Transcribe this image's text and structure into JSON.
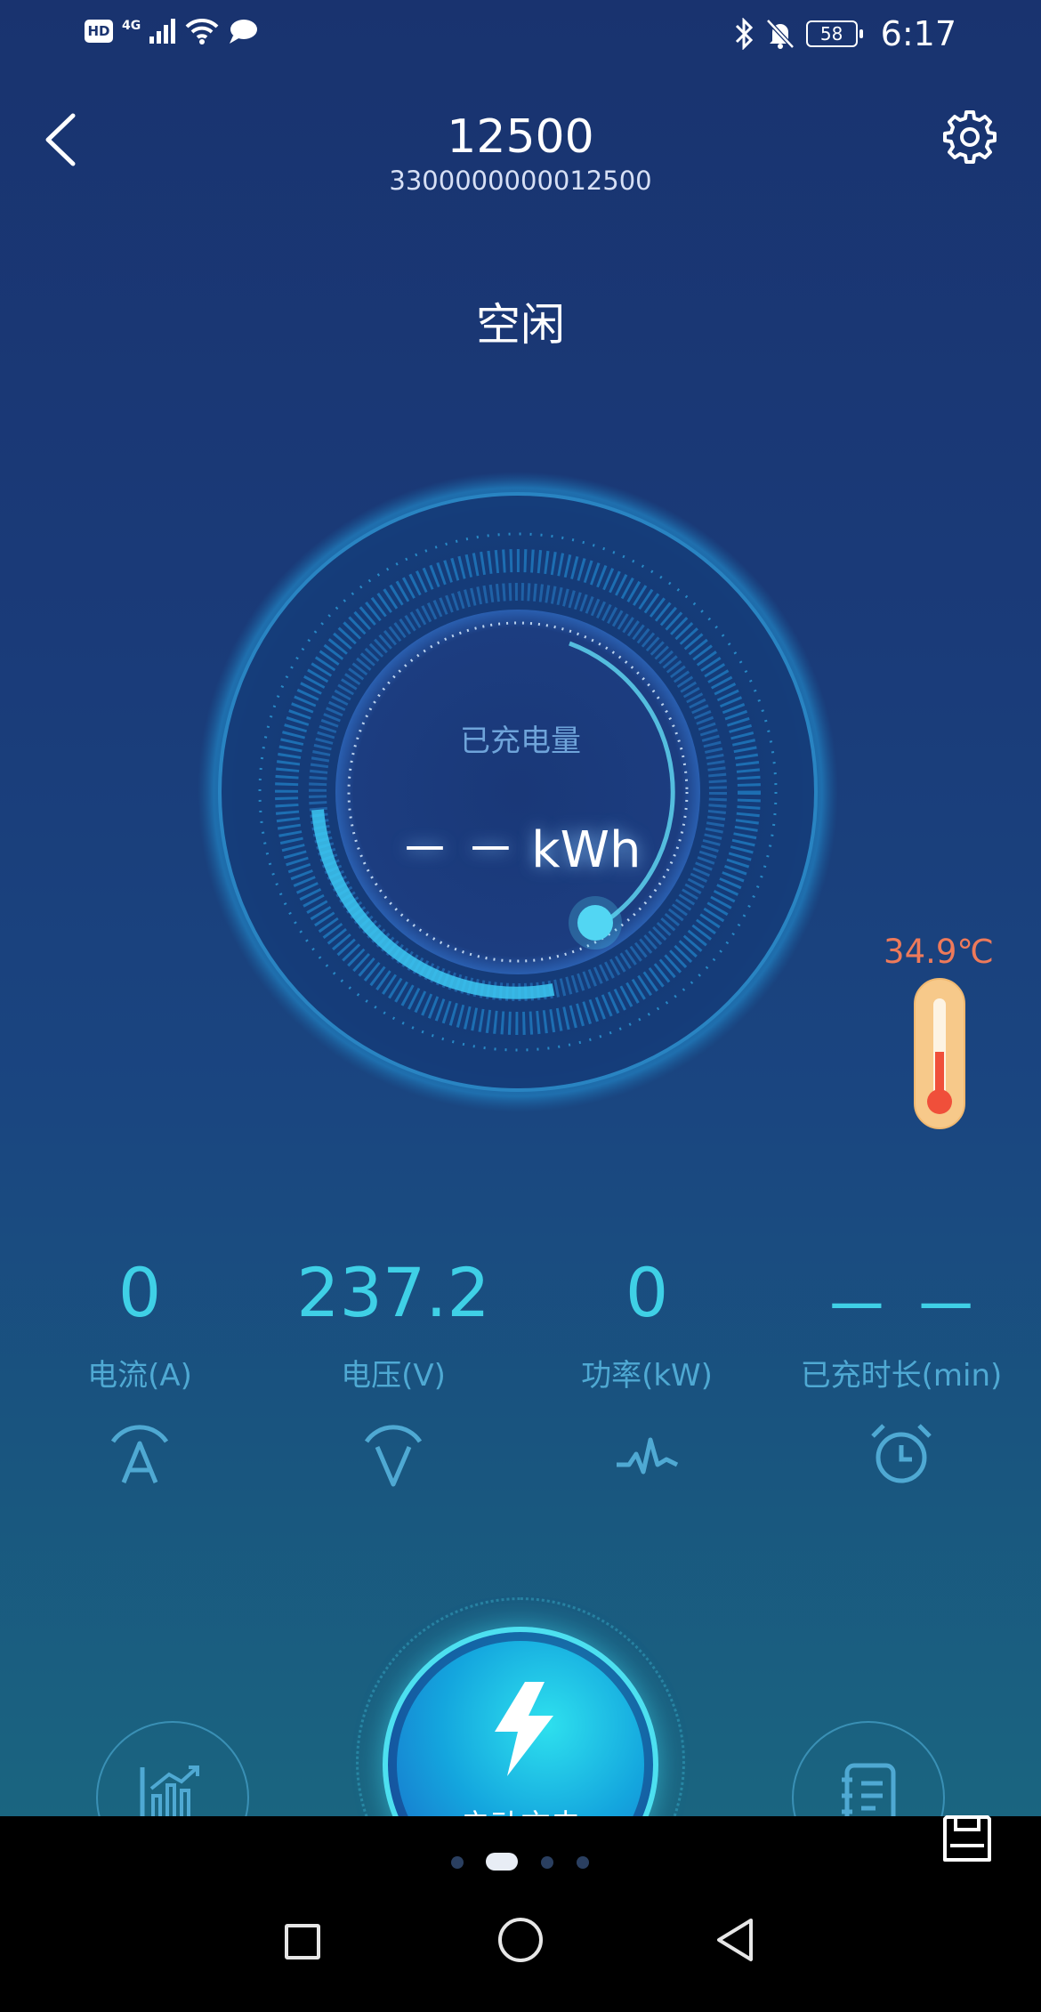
{
  "status_bar": {
    "hd": "HD",
    "network": "4G",
    "battery": "58",
    "time": "6:17"
  },
  "header": {
    "title": "12500",
    "subtitle": "3300000000012500"
  },
  "state": "空闲",
  "gauge": {
    "label": "已充电量",
    "value": "－ － kWh"
  },
  "temperature": {
    "value": "34.9℃"
  },
  "metrics": [
    {
      "value": "0",
      "label": "电流(A)",
      "icon": "current-icon"
    },
    {
      "value": "237.2",
      "label": "电压(V)",
      "icon": "voltage-icon"
    },
    {
      "value": "0",
      "label": "功率(kW)",
      "icon": "power-icon"
    },
    {
      "value": "－ －",
      "label": "已充时长(min)",
      "icon": "alarm-clock-icon"
    }
  ],
  "actions": {
    "start_label": "启动充电"
  },
  "colors": {
    "accent": "#3fd0e6",
    "temperature": "#ee7a5a",
    "background_top": "#19336f"
  }
}
